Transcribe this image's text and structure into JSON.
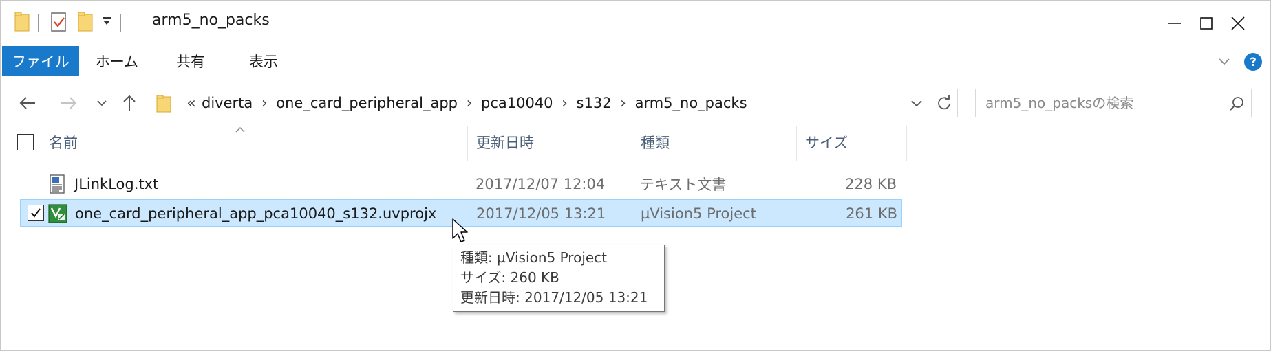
{
  "titlebar": {
    "title": "arm5_no_packs",
    "qa_items": [
      "folder-icon",
      "properties-icon",
      "new-folder-icon",
      "customize-dropdown-icon"
    ],
    "controls": [
      "minimize-icon",
      "maximize-icon",
      "close-icon"
    ]
  },
  "ribbon": {
    "tabs": [
      {
        "label": "ファイル",
        "active": true
      },
      {
        "label": "ホーム",
        "active": false
      },
      {
        "label": "共有",
        "active": false
      },
      {
        "label": "表示",
        "active": false
      }
    ],
    "accent_color": "#1979ca"
  },
  "navigation": {
    "breadcrumb_lead": "«",
    "breadcrumb": [
      "diverta",
      "one_card_peripheral_app",
      "pca10040",
      "s132",
      "arm5_no_packs"
    ],
    "search_placeholder": "arm5_no_packsの検索"
  },
  "columns": {
    "name": "名前",
    "modified": "更新日時",
    "type": "種類",
    "size": "サイズ"
  },
  "files": [
    {
      "name": "JLinkLog.txt",
      "modified": "2017/12/07 12:04",
      "type": "テキスト文書",
      "size": "228 KB",
      "selected": false,
      "icon": "text-file-icon"
    },
    {
      "name": "one_card_peripheral_app_pca10040_s132.uvprojx",
      "modified": "2017/12/05 13:21",
      "type": "µVision5 Project",
      "size": "261 KB",
      "selected": true,
      "icon": "uvision-project-icon"
    }
  ],
  "tooltip": {
    "line1": "種類: µVision5 Project",
    "line2": "サイズ: 260 KB",
    "line3": "更新日時: 2017/12/05 13:21"
  },
  "colors": {
    "selection_bg": "#cce8ff",
    "selection_border": "#99d1ff",
    "header_text": "#4c607a"
  }
}
